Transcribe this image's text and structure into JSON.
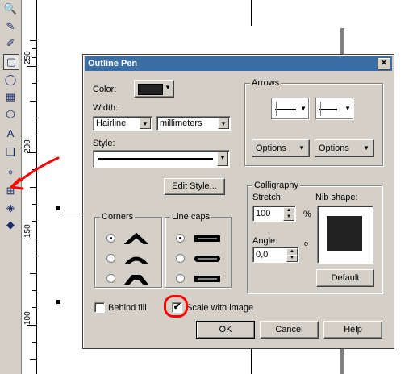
{
  "ruler": {
    "labels": [
      "250",
      "200",
      "150",
      "100"
    ]
  },
  "dialog": {
    "title": "Outline Pen",
    "close_glyph": "✕",
    "color_label": "Color:",
    "color_value": "#222222",
    "width_label": "Width:",
    "width_value": "Hairline",
    "units_value": "millimeters",
    "style_label": "Style:",
    "edit_style_button": "Edit Style...",
    "arrows_title": "Arrows",
    "options_left": "Options",
    "options_right": "Options",
    "corners_title": "Corners",
    "linecaps_title": "Line caps",
    "calligraphy_title": "Calligraphy",
    "stretch_label": "Stretch:",
    "stretch_value": "100",
    "stretch_unit": "%",
    "angle_label": "Angle:",
    "angle_value": "0,0",
    "angle_unit": "o",
    "nib_shape_label": "Nib shape:",
    "default_button": "Default",
    "behind_fill_label": "Behind fill",
    "behind_fill_checked": false,
    "scale_with_image_label": "Scale with image",
    "scale_with_image_checked": true,
    "ok_button": "OK",
    "cancel_button": "Cancel",
    "help_button": "Help"
  },
  "annotation_color": "#ff0000"
}
